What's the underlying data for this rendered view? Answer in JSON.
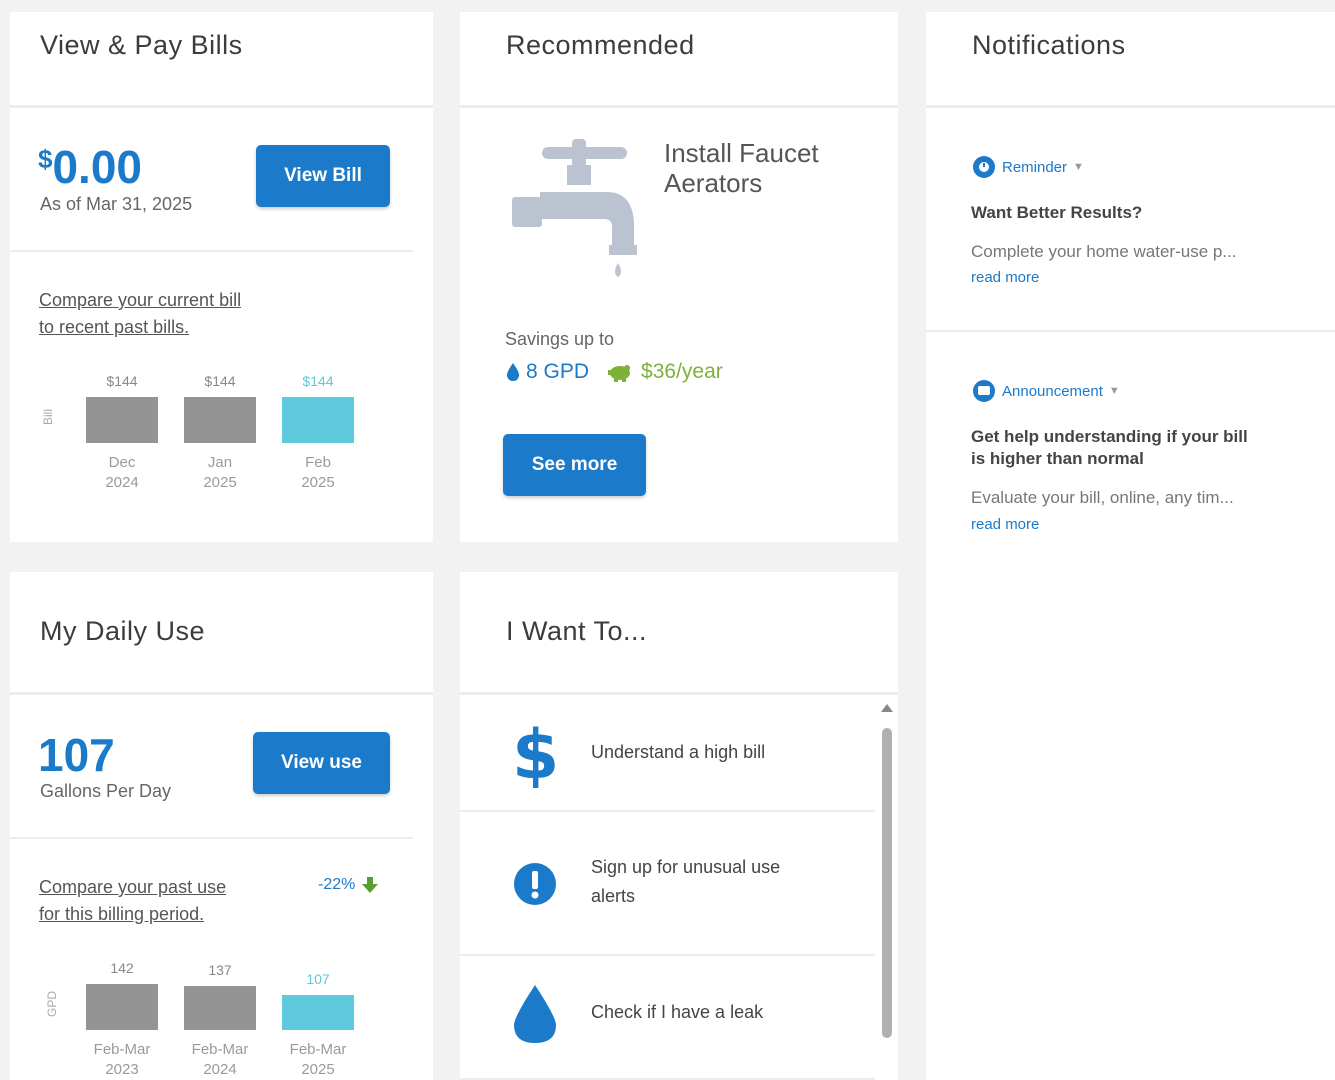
{
  "bills": {
    "title": "View & Pay Bills",
    "currency": "$",
    "amount": "0.00",
    "as_of": "As of Mar 31, 2025",
    "button": "View Bill",
    "compare_line1": "Compare your current bill",
    "compare_line2": "to recent past bills.",
    "axis": "Bill",
    "chart_data": {
      "type": "bar",
      "categories": [
        "Dec 2024",
        "Jan 2025",
        "Feb 2025"
      ],
      "values": [
        144,
        144,
        144
      ],
      "value_labels": [
        "$144",
        "$144",
        "$144"
      ],
      "cat_line1": [
        "Dec",
        "Jan",
        "Feb"
      ],
      "cat_line2": [
        "2024",
        "2025",
        "2025"
      ],
      "ylabel": "Bill",
      "colors": [
        "#949494",
        "#949494",
        "#5ec8dc"
      ]
    }
  },
  "recommended": {
    "title": "Recommended",
    "item_line1": "Install Faucet",
    "item_line2": "Aerators",
    "savings_label": "Savings up to",
    "gpd": "8 GPD",
    "money": "$36/year",
    "button": "See more"
  },
  "notifications": {
    "title": "Notifications",
    "items": [
      {
        "tag": "Reminder",
        "heading": "Want Better Results?",
        "heading2": "",
        "body": "Complete your home water-use p...",
        "read_more": "read more"
      },
      {
        "tag": "Announcement",
        "heading": "Get help understanding if your bill",
        "heading2": "is higher than normal",
        "body": "Evaluate your bill, online, any tim...",
        "read_more": "read more"
      }
    ]
  },
  "daily": {
    "title": "My Daily Use",
    "amount": "107",
    "unit": "Gallons Per Day",
    "button": "View use",
    "compare_line1": "Compare your past use",
    "compare_line2": "for this billing period.",
    "change": "-22%",
    "axis": "GPD",
    "chart_data": {
      "type": "bar",
      "categories": [
        "Feb-Mar 2023",
        "Feb-Mar 2024",
        "Feb-Mar 2025"
      ],
      "values": [
        142,
        137,
        107
      ],
      "value_labels": [
        "142",
        "137",
        "107"
      ],
      "cat_line1": [
        "Feb-Mar",
        "Feb-Mar",
        "Feb-Mar"
      ],
      "cat_line2": [
        "2023",
        "2024",
        "2025"
      ],
      "ylabel": "GPD",
      "colors": [
        "#949494",
        "#949494",
        "#5ec8dc"
      ]
    }
  },
  "want": {
    "title": "I Want To...",
    "items": [
      {
        "icon": "dollar-icon",
        "label1": "Understand a high bill",
        "label2": ""
      },
      {
        "icon": "exclamation-icon",
        "label1": "Sign up for unusual use",
        "label2": "alerts"
      },
      {
        "icon": "water-drop-icon",
        "label1": "Check if I have a leak",
        "label2": ""
      }
    ]
  },
  "colors": {
    "accent": "#1b7ac9",
    "highlight_bar": "#5ec8dc",
    "past_bar": "#949494",
    "savings_green": "#7db23a"
  }
}
